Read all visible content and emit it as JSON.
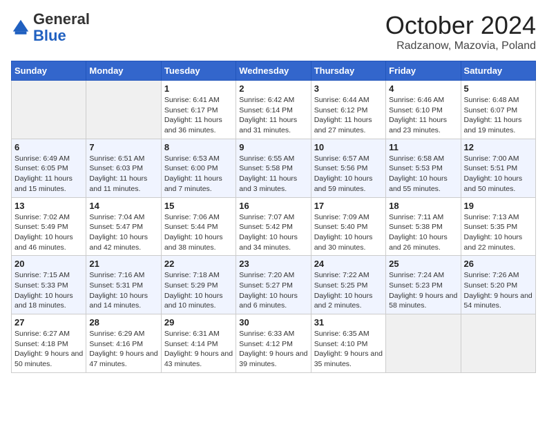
{
  "header": {
    "logo_general": "General",
    "logo_blue": "Blue",
    "month_title": "October 2024",
    "location": "Radzanow, Mazovia, Poland"
  },
  "days_of_week": [
    "Sunday",
    "Monday",
    "Tuesday",
    "Wednesday",
    "Thursday",
    "Friday",
    "Saturday"
  ],
  "weeks": [
    [
      {
        "day": "",
        "sunrise": "",
        "sunset": "",
        "daylight": ""
      },
      {
        "day": "",
        "sunrise": "",
        "sunset": "",
        "daylight": ""
      },
      {
        "day": "1",
        "sunrise": "Sunrise: 6:41 AM",
        "sunset": "Sunset: 6:17 PM",
        "daylight": "Daylight: 11 hours and 36 minutes."
      },
      {
        "day": "2",
        "sunrise": "Sunrise: 6:42 AM",
        "sunset": "Sunset: 6:14 PM",
        "daylight": "Daylight: 11 hours and 31 minutes."
      },
      {
        "day": "3",
        "sunrise": "Sunrise: 6:44 AM",
        "sunset": "Sunset: 6:12 PM",
        "daylight": "Daylight: 11 hours and 27 minutes."
      },
      {
        "day": "4",
        "sunrise": "Sunrise: 6:46 AM",
        "sunset": "Sunset: 6:10 PM",
        "daylight": "Daylight: 11 hours and 23 minutes."
      },
      {
        "day": "5",
        "sunrise": "Sunrise: 6:48 AM",
        "sunset": "Sunset: 6:07 PM",
        "daylight": "Daylight: 11 hours and 19 minutes."
      }
    ],
    [
      {
        "day": "6",
        "sunrise": "Sunrise: 6:49 AM",
        "sunset": "Sunset: 6:05 PM",
        "daylight": "Daylight: 11 hours and 15 minutes."
      },
      {
        "day": "7",
        "sunrise": "Sunrise: 6:51 AM",
        "sunset": "Sunset: 6:03 PM",
        "daylight": "Daylight: 11 hours and 11 minutes."
      },
      {
        "day": "8",
        "sunrise": "Sunrise: 6:53 AM",
        "sunset": "Sunset: 6:00 PM",
        "daylight": "Daylight: 11 hours and 7 minutes."
      },
      {
        "day": "9",
        "sunrise": "Sunrise: 6:55 AM",
        "sunset": "Sunset: 5:58 PM",
        "daylight": "Daylight: 11 hours and 3 minutes."
      },
      {
        "day": "10",
        "sunrise": "Sunrise: 6:57 AM",
        "sunset": "Sunset: 5:56 PM",
        "daylight": "Daylight: 10 hours and 59 minutes."
      },
      {
        "day": "11",
        "sunrise": "Sunrise: 6:58 AM",
        "sunset": "Sunset: 5:53 PM",
        "daylight": "Daylight: 10 hours and 55 minutes."
      },
      {
        "day": "12",
        "sunrise": "Sunrise: 7:00 AM",
        "sunset": "Sunset: 5:51 PM",
        "daylight": "Daylight: 10 hours and 50 minutes."
      }
    ],
    [
      {
        "day": "13",
        "sunrise": "Sunrise: 7:02 AM",
        "sunset": "Sunset: 5:49 PM",
        "daylight": "Daylight: 10 hours and 46 minutes."
      },
      {
        "day": "14",
        "sunrise": "Sunrise: 7:04 AM",
        "sunset": "Sunset: 5:47 PM",
        "daylight": "Daylight: 10 hours and 42 minutes."
      },
      {
        "day": "15",
        "sunrise": "Sunrise: 7:06 AM",
        "sunset": "Sunset: 5:44 PM",
        "daylight": "Daylight: 10 hours and 38 minutes."
      },
      {
        "day": "16",
        "sunrise": "Sunrise: 7:07 AM",
        "sunset": "Sunset: 5:42 PM",
        "daylight": "Daylight: 10 hours and 34 minutes."
      },
      {
        "day": "17",
        "sunrise": "Sunrise: 7:09 AM",
        "sunset": "Sunset: 5:40 PM",
        "daylight": "Daylight: 10 hours and 30 minutes."
      },
      {
        "day": "18",
        "sunrise": "Sunrise: 7:11 AM",
        "sunset": "Sunset: 5:38 PM",
        "daylight": "Daylight: 10 hours and 26 minutes."
      },
      {
        "day": "19",
        "sunrise": "Sunrise: 7:13 AM",
        "sunset": "Sunset: 5:35 PM",
        "daylight": "Daylight: 10 hours and 22 minutes."
      }
    ],
    [
      {
        "day": "20",
        "sunrise": "Sunrise: 7:15 AM",
        "sunset": "Sunset: 5:33 PM",
        "daylight": "Daylight: 10 hours and 18 minutes."
      },
      {
        "day": "21",
        "sunrise": "Sunrise: 7:16 AM",
        "sunset": "Sunset: 5:31 PM",
        "daylight": "Daylight: 10 hours and 14 minutes."
      },
      {
        "day": "22",
        "sunrise": "Sunrise: 7:18 AM",
        "sunset": "Sunset: 5:29 PM",
        "daylight": "Daylight: 10 hours and 10 minutes."
      },
      {
        "day": "23",
        "sunrise": "Sunrise: 7:20 AM",
        "sunset": "Sunset: 5:27 PM",
        "daylight": "Daylight: 10 hours and 6 minutes."
      },
      {
        "day": "24",
        "sunrise": "Sunrise: 7:22 AM",
        "sunset": "Sunset: 5:25 PM",
        "daylight": "Daylight: 10 hours and 2 minutes."
      },
      {
        "day": "25",
        "sunrise": "Sunrise: 7:24 AM",
        "sunset": "Sunset: 5:23 PM",
        "daylight": "Daylight: 9 hours and 58 minutes."
      },
      {
        "day": "26",
        "sunrise": "Sunrise: 7:26 AM",
        "sunset": "Sunset: 5:20 PM",
        "daylight": "Daylight: 9 hours and 54 minutes."
      }
    ],
    [
      {
        "day": "27",
        "sunrise": "Sunrise: 6:27 AM",
        "sunset": "Sunset: 4:18 PM",
        "daylight": "Daylight: 9 hours and 50 minutes."
      },
      {
        "day": "28",
        "sunrise": "Sunrise: 6:29 AM",
        "sunset": "Sunset: 4:16 PM",
        "daylight": "Daylight: 9 hours and 47 minutes."
      },
      {
        "day": "29",
        "sunrise": "Sunrise: 6:31 AM",
        "sunset": "Sunset: 4:14 PM",
        "daylight": "Daylight: 9 hours and 43 minutes."
      },
      {
        "day": "30",
        "sunrise": "Sunrise: 6:33 AM",
        "sunset": "Sunset: 4:12 PM",
        "daylight": "Daylight: 9 hours and 39 minutes."
      },
      {
        "day": "31",
        "sunrise": "Sunrise: 6:35 AM",
        "sunset": "Sunset: 4:10 PM",
        "daylight": "Daylight: 9 hours and 35 minutes."
      },
      {
        "day": "",
        "sunrise": "",
        "sunset": "",
        "daylight": ""
      },
      {
        "day": "",
        "sunrise": "",
        "sunset": "",
        "daylight": ""
      }
    ]
  ]
}
